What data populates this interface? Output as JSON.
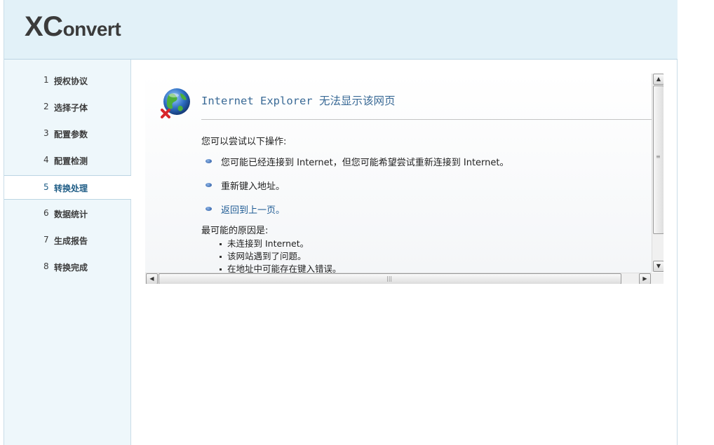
{
  "app": {
    "logo_big": "XC",
    "logo_small": "onvert"
  },
  "sidebar": {
    "items": [
      {
        "num": "1",
        "label": "授权协议"
      },
      {
        "num": "2",
        "label": "选择子体"
      },
      {
        "num": "3",
        "label": "配置参数"
      },
      {
        "num": "4",
        "label": "配置检测"
      },
      {
        "num": "5",
        "label": "转换处理"
      },
      {
        "num": "6",
        "label": "数据统计"
      },
      {
        "num": "7",
        "label": "生成报告"
      },
      {
        "num": "8",
        "label": "转换完成"
      }
    ],
    "active_index": 4
  },
  "ie_error": {
    "title": "Internet Explorer 无法显示该网页",
    "try_heading": "您可以尝试以下操作:",
    "suggestions": [
      "您可能已经连接到 Internet，但您可能希望尝试重新连接到 Internet。",
      "重新键入地址。",
      "返回到上一页。"
    ],
    "reason_heading": "最可能的原因是:",
    "reasons": [
      "未连接到 Internet。",
      "该网站遇到了问题。",
      "在地址中可能存在键入错误。"
    ],
    "icon": "globe-error-icon"
  },
  "colors": {
    "header_bg": "#e2f1f8",
    "sidebar_bg": "#eef7fb",
    "active_step_text": "#1f5d86",
    "ie_title": "#3a6a96",
    "link": "#1f5b94"
  }
}
